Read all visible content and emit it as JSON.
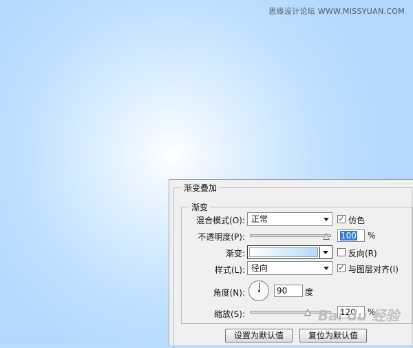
{
  "watermark": "思缘设计论坛 WWW.MISSYUAN.COM",
  "baidu_watermark": "Bai du 经验",
  "panel": {
    "section_title": "渐变叠加",
    "group_title": "渐变",
    "blend_mode": {
      "label": "混合模式(O):",
      "value": "正常"
    },
    "dither": {
      "label": "仿色",
      "checked": true
    },
    "opacity": {
      "label": "不透明度(P):",
      "value": "100",
      "unit": "%",
      "level_percent": 100
    },
    "gradient": {
      "label": "渐变:",
      "colors": [
        "#ffffff",
        "#b5d9ff"
      ]
    },
    "reverse": {
      "label": "反向(R)",
      "checked": false
    },
    "style": {
      "label": "样式(L):",
      "value": "径向"
    },
    "align_layer": {
      "label": "与图层对齐(I)",
      "checked": true
    },
    "angle": {
      "label": "角度(N):",
      "value": "90",
      "unit": "度"
    },
    "scale": {
      "label": "缩放(S):",
      "value": "120",
      "unit": "%",
      "level_percent": 120
    },
    "buttons": {
      "make_default": "设置为默认值",
      "reset_default": "复位为默认值"
    }
  },
  "colors": {
    "background_center": "#ffffff",
    "background_edge": "#b3d8ff",
    "selection": "#3a7bd5"
  }
}
